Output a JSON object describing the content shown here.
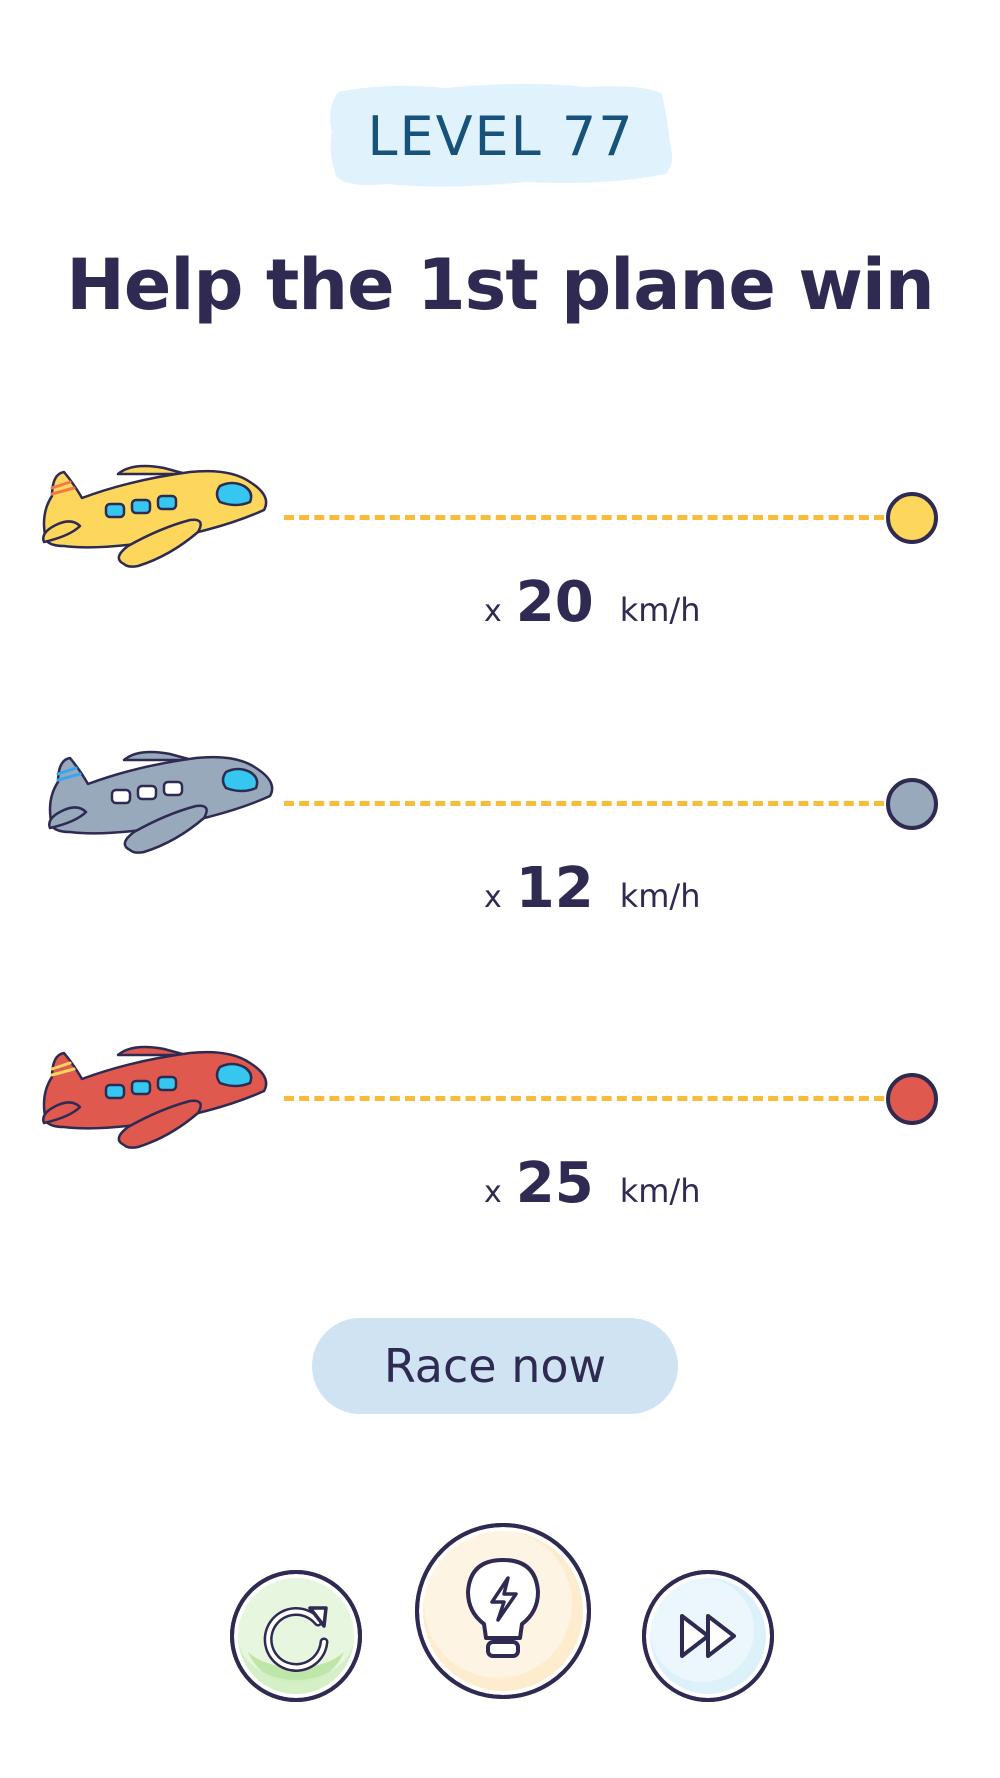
{
  "level": {
    "label": "LEVEL 77"
  },
  "title": "Help the 1st plane win",
  "lanes": [
    {
      "color": "#fdd75c",
      "multiplier": "x",
      "speed": "20",
      "unit": "km/h"
    },
    {
      "color": "#98a9bb",
      "multiplier": "x",
      "speed": "12",
      "unit": "km/h"
    },
    {
      "color": "#e0594f",
      "multiplier": "x",
      "speed": "25",
      "unit": "km/h"
    }
  ],
  "race_button": {
    "label": "Race now"
  },
  "controls": {
    "restart": {
      "icon": "restart-icon",
      "color": "#d4efc4"
    },
    "hint": {
      "icon": "lightbulb-icon",
      "color": "#fde9c4"
    },
    "skip": {
      "icon": "fast-forward-icon",
      "color": "#d9effb"
    }
  },
  "colors": {
    "ink": "#2e2a52",
    "track": "#f7bd3a",
    "level_text": "#17527a",
    "level_bg": "#e0f3fc"
  }
}
